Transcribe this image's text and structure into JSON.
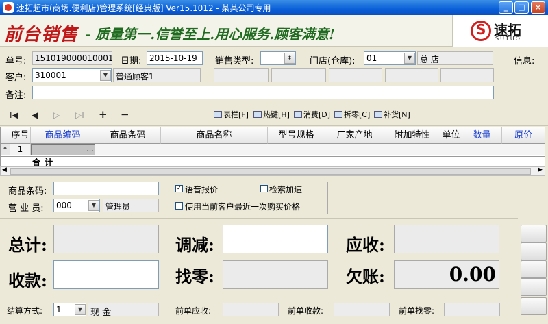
{
  "window": {
    "title": "速拓超市(商场.便利店)管理系统[经典版] Ver15.1012 - 某某公司专用",
    "minimize": "_",
    "maximize": "□",
    "close": "×"
  },
  "banner": {
    "title": "前台销售",
    "slogan": "- 质量第一.信誉至上.用心服务.顾客满意!",
    "logo_text": "速拓",
    "logo_sub": "SUTUO"
  },
  "form": {
    "order_no_label": "单号:",
    "order_no": "151019000010001",
    "date_label": "日期:",
    "date": "2015-10-19",
    "sale_type_label": "销售类型:",
    "sale_type": "",
    "store_label": "门店(仓库):",
    "store_code": "01",
    "store_name": "总 店",
    "info_label": "信息:",
    "customer_label": "客户:",
    "customer_code": "310001",
    "customer_name": "普通顾客1",
    "remark_label": "备注:",
    "remark": ""
  },
  "toolbar": {
    "nav_first": "I◀",
    "nav_prev": "◀",
    "nav_next": "▷",
    "nav_last": "▷I",
    "nav_add": "+",
    "nav_remove": "−",
    "btn_table": "表栏[F]",
    "btn_hotkey": "热键[H]",
    "btn_consume": "消费[D]",
    "btn_split": "拆零[C]",
    "btn_restock": "补货[N]"
  },
  "grid": {
    "columns": [
      "序号",
      "商品编码",
      "商品条码",
      "商品名称",
      "型号规格",
      "厂家产地",
      "附加特性",
      "单位",
      "数量",
      "原价"
    ],
    "row_marker": "*",
    "row_no": "1",
    "total_label": "合 计"
  },
  "lower": {
    "barcode_label": "商品条码:",
    "barcode": "",
    "voice_label": "语音报价",
    "voice_checked": true,
    "fast_search_label": "检索加速",
    "fast_search_checked": false,
    "clerk_label": "营 业 员:",
    "clerk_code": "000",
    "clerk_name": "管理员",
    "last_price_label": "使用当前客户最近一次购买价格",
    "last_price_checked": false
  },
  "totals": {
    "total_label": "总计:",
    "total_value": "",
    "adjust_label": "调减:",
    "adjust_value": "",
    "receivable_label": "应收:",
    "receivable_value": "",
    "received_label": "收款:",
    "received_value": "",
    "change_label": "找零:",
    "change_value": "",
    "owed_label": "欠账:",
    "owed_value": "0.00"
  },
  "bottom": {
    "settle_label": "结算方式:",
    "settle_code": "1",
    "settle_name": "现 金",
    "prev_receivable_label": "前单应收:",
    "prev_received_label": "前单收款:",
    "prev_change_label": "前单找零:"
  }
}
